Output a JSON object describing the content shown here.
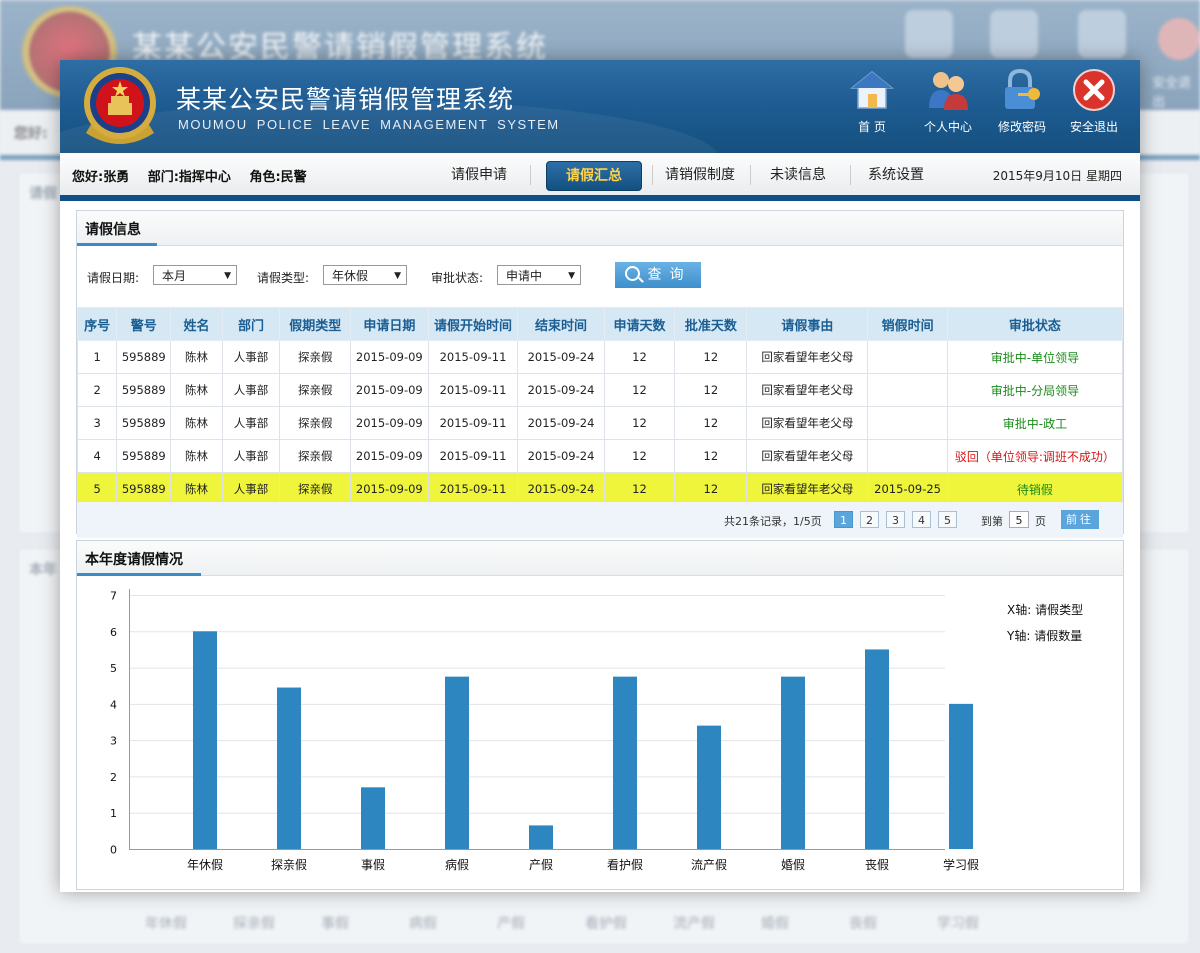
{
  "app": {
    "title": "某某公安民警请销假管理系统",
    "subtitle": "MOUMOU POLICE LEAVE MANAGEMENT SYSTEM"
  },
  "header_buttons": [
    {
      "label": "首 页",
      "icon": "home-icon"
    },
    {
      "label": "个人中心",
      "icon": "users-icon"
    },
    {
      "label": "修改密码",
      "icon": "lock-key-icon"
    },
    {
      "label": "安全退出",
      "icon": "close-icon"
    }
  ],
  "user": {
    "greeting": "您好:张勇",
    "department": "部门:指挥中心",
    "role": "角色:民警"
  },
  "nav": {
    "items": [
      "请假申请",
      "请假汇总",
      "请销假制度",
      "未读信息",
      "系统设置"
    ],
    "active": "请假汇总"
  },
  "date": "2015年9月10日 星期四",
  "leave_panel": {
    "title": "请假信息",
    "filters": {
      "date_label": "请假日期:",
      "date_value": "本月",
      "type_label": "请假类型:",
      "type_value": "年休假",
      "status_label": "审批状态:",
      "status_value": "申请中",
      "query_button": "查询"
    },
    "columns": [
      "序号",
      "警号",
      "姓名",
      "部门",
      "假期类型",
      "申请日期",
      "请假开始时间",
      "结束时间",
      "申请天数",
      "批准天数",
      "请假事由",
      "销假时间",
      "审批状态"
    ],
    "rows": [
      [
        "1",
        "595889",
        "陈林",
        "人事部",
        "探亲假",
        "2015-09-09",
        "2015-09-11",
        "2015-09-24",
        "12",
        "12",
        "回家看望年老父母",
        "",
        "审批中-单位领导"
      ],
      [
        "2",
        "595889",
        "陈林",
        "人事部",
        "探亲假",
        "2015-09-09",
        "2015-09-11",
        "2015-09-24",
        "12",
        "12",
        "回家看望年老父母",
        "",
        "审批中-分局领导"
      ],
      [
        "3",
        "595889",
        "陈林",
        "人事部",
        "探亲假",
        "2015-09-09",
        "2015-09-11",
        "2015-09-24",
        "12",
        "12",
        "回家看望年老父母",
        "",
        "审批中-政工"
      ],
      [
        "4",
        "595889",
        "陈林",
        "人事部",
        "探亲假",
        "2015-09-09",
        "2015-09-11",
        "2015-09-24",
        "12",
        "12",
        "回家看望年老父母",
        "",
        "驳回（单位领导:调班不成功）"
      ],
      [
        "5",
        "595889",
        "陈林",
        "人事部",
        "探亲假",
        "2015-09-09",
        "2015-09-11",
        "2015-09-24",
        "12",
        "12",
        "回家看望年老父母",
        "2015-09-25",
        "待销假"
      ]
    ],
    "status_colors": {
      "pending": "#1a8a1a",
      "rejected": "#d61515"
    },
    "highlight_row_color": "#eef53a",
    "pagination": {
      "info": "共21条记录，1/5页",
      "pages": [
        "1",
        "2",
        "3",
        "4",
        "5"
      ],
      "current": "1",
      "goto_label": "到第",
      "goto_value": "5",
      "page_label": "页",
      "go_button": "前往"
    }
  },
  "chart_panel": {
    "title": "本年度请假情况",
    "x_note": "X轴: 请假类型",
    "y_note": "Y轴: 请假数量"
  },
  "chart_data": {
    "type": "bar",
    "categories": [
      "年休假",
      "探亲假",
      "事假",
      "病假",
      "产假",
      "看护假",
      "流产假",
      "婚假",
      "丧假",
      "学习假"
    ],
    "values": [
      6.0,
      4.45,
      1.7,
      4.75,
      0.65,
      4.75,
      3.4,
      4.75,
      5.5,
      4.0
    ],
    "ylim": [
      0,
      7
    ],
    "yticks": [
      "0",
      "1",
      "2",
      "3",
      "4",
      "5",
      "6",
      "7"
    ],
    "grid": true,
    "bar_color": "#2e86c1"
  },
  "background_page": {
    "title": "某某公安民警请销假管理系统",
    "greeting": "您好:",
    "panel1_title": "请假",
    "panel2_title": "本年",
    "exit_label": "安全退出",
    "categories": [
      "年休假",
      "探亲假",
      "事假",
      "病假",
      "产假",
      "看护假",
      "流产假",
      "婚假",
      "丧假",
      "学习假"
    ]
  }
}
